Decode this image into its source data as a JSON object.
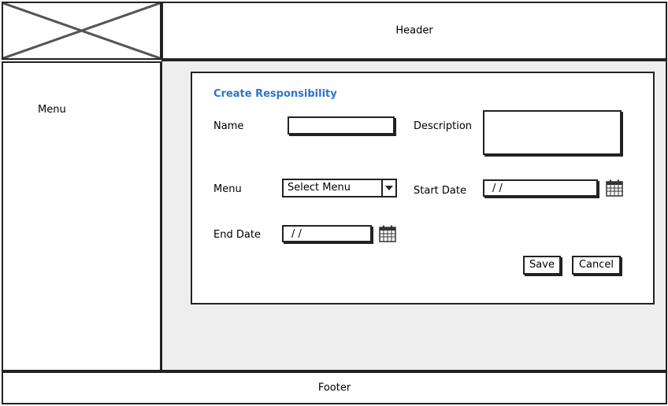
{
  "header": {
    "label": "Header"
  },
  "sidebar": {
    "label": "Menu"
  },
  "footer": {
    "label": "Footer"
  },
  "form": {
    "title": "Create Responsibility",
    "name_label": "Name",
    "name_value": "",
    "description_label": "Description",
    "description_value": "",
    "menu_label": "Menu",
    "menu_selected": "Select Menu",
    "start_date_label": "Start Date",
    "start_date_value": "/ /",
    "end_date_label": "End Date",
    "end_date_value": "/ /",
    "save_label": "Save",
    "cancel_label": "Cancel"
  },
  "icons": {
    "logo": "image-placeholder-icon",
    "calendar": "calendar-icon",
    "dropdown": "chevron-down-icon"
  }
}
